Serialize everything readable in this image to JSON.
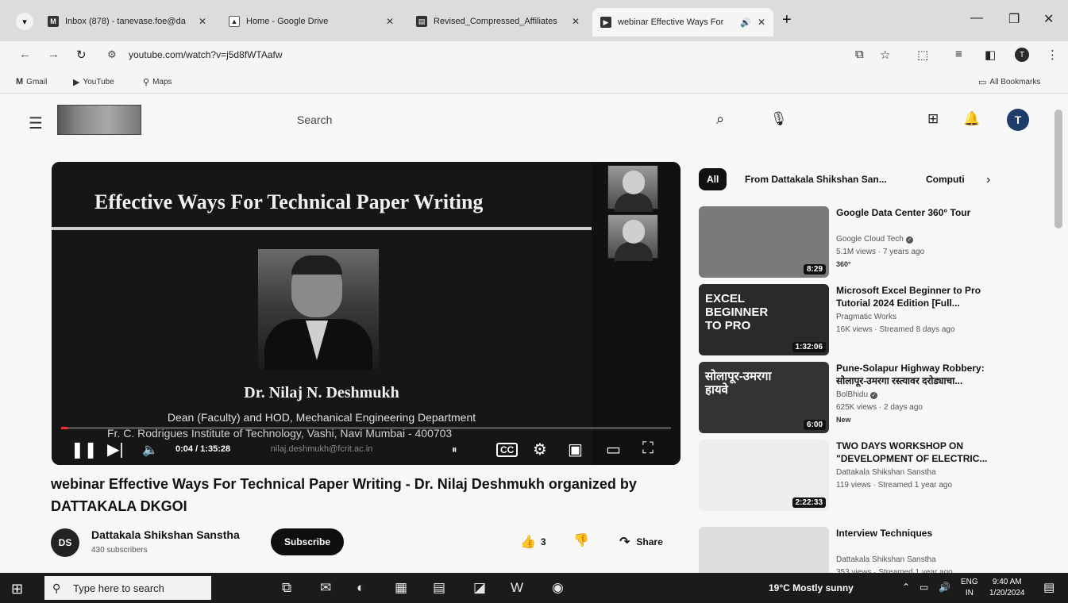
{
  "browser": {
    "tabs": [
      {
        "title": "Inbox (878) - tanevase.foe@da",
        "favicon": "gmail-icon"
      },
      {
        "title": "Home - Google Drive",
        "favicon": "drive-icon"
      },
      {
        "title": "Revised_Compressed_Affiliates",
        "favicon": "doc-icon"
      },
      {
        "title": "webinar Effective Ways For",
        "favicon": "youtube-icon"
      }
    ],
    "url": "youtube.com/watch?v=j5d8fWTAafw",
    "profile_initial": "T",
    "bookmarks": [
      {
        "label": "Gmail",
        "icon": "gmail-icon"
      },
      {
        "label": "YouTube",
        "icon": "youtube-icon"
      },
      {
        "label": "Maps",
        "icon": "map-pin-icon"
      }
    ],
    "all_bookmarks": "All Bookmarks"
  },
  "youtube": {
    "search_placeholder": "Search",
    "avatar_initial": "T"
  },
  "player": {
    "slide_title": "Effective Ways For Technical Paper Writing",
    "presenter": "Dr. Nilaj N. Deshmukh",
    "role": "Dean (Faculty) and HOD, Mechanical Engineering Department",
    "institute": "Fr. C. Rodrigues Institute of Technology, Vashi, Navi Mumbai - 400703",
    "email": "nilaj.deshmukh@fcrit.ac.in",
    "timecode": "0:04 / 1:35:28",
    "progress": 0.01
  },
  "video": {
    "title": "webinar Effective Ways For Technical Paper Writing - Dr. Nilaj Deshmukh organized by DATTAKALA DKGOI",
    "channel_name": "Dattakala Shikshan Sanstha",
    "channel_avatar": "DS",
    "subscribers": "430 subscribers",
    "subscribe_label": "Subscribe",
    "likes": "3",
    "share_label": "Share"
  },
  "sidebar": {
    "chips": [
      "All",
      "From Dattakala Shikshan San...",
      "Computi"
    ],
    "recommendations": [
      {
        "title": "Google Data Center 360° Tour",
        "channel": "Google Cloud Tech",
        "verified": true,
        "meta": "5.1M views · 7 years ago",
        "badge": "360°",
        "duration": "8:29",
        "thumb_color": "#7a7a7a",
        "thumb_label": ""
      },
      {
        "title": "Microsoft Excel Beginner to Pro Tutorial 2024 Edition [Full...",
        "channel": "Pragmatic Works",
        "verified": false,
        "meta": "16K views · Streamed 8 days ago",
        "badge": "",
        "duration": "1:32:06",
        "thumb_color": "#2a2a2a",
        "thumb_label": "EXCEL BEGINNER TO PRO"
      },
      {
        "title": "Pune-Solapur Highway Robbery: सोलापूर-उमरगा रस्त्यावर दरोड्याचा...",
        "channel": "BolBhidu",
        "verified": true,
        "meta": "625K views · 2 days ago",
        "badge": "New",
        "duration": "6:00",
        "thumb_color": "#333333",
        "thumb_label": "सोलापूर-उमरगा हायवे"
      },
      {
        "title": "TWO DAYS WORKSHOP ON \"DEVELOPMENT OF ELECTRIC...",
        "channel": "Dattakala Shikshan Sanstha",
        "verified": false,
        "meta": "119 views · Streamed 1 year ago",
        "badge": "",
        "duration": "2:22:33",
        "thumb_color": "#eeeeee",
        "thumb_label": ""
      },
      {
        "title": "Interview Techniques",
        "channel": "Dattakala Shikshan Sanstha",
        "verified": false,
        "meta": "353 views · Streamed 1 year ago",
        "badge": "",
        "duration": "",
        "thumb_color": "#dddddd",
        "thumb_label": ""
      }
    ]
  },
  "taskbar": {
    "search_placeholder": "Type here to search",
    "weather": "19°C  Mostly sunny",
    "lang_1": "ENG",
    "lang_2": "IN",
    "time": "9:40 AM",
    "date": "1/20/2024"
  }
}
